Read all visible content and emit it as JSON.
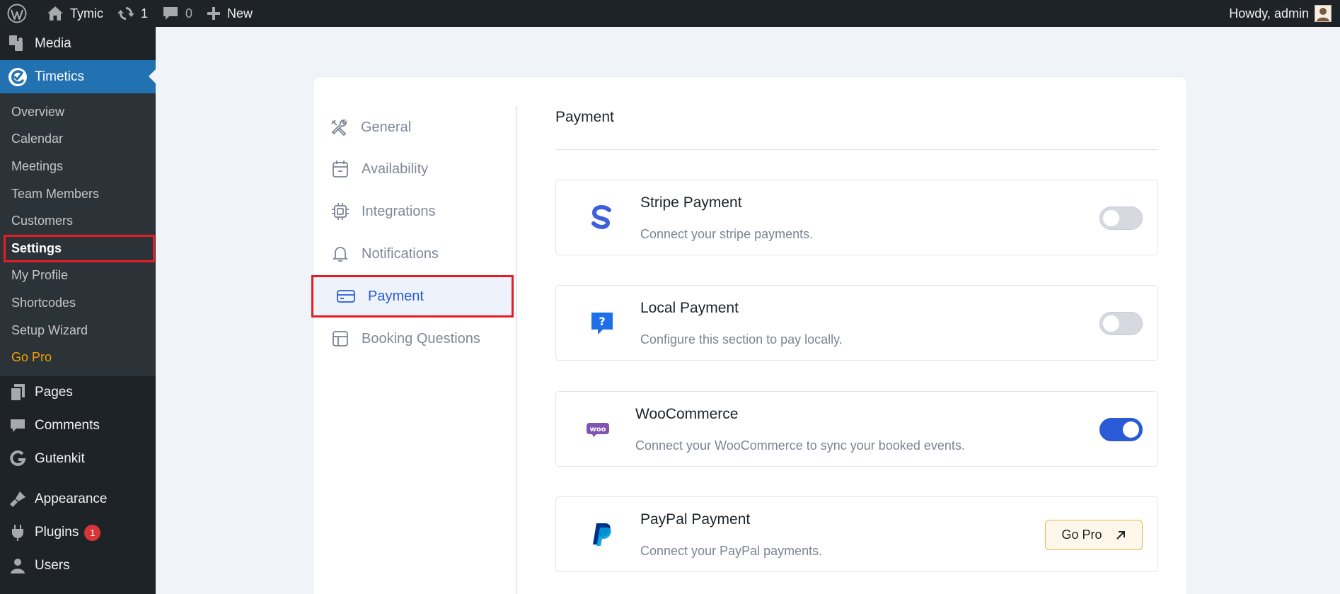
{
  "admin_bar": {
    "site_name": "Tymic",
    "updates_count": "1",
    "comments_count": "0",
    "new_label": "New",
    "howdy": "Howdy, admin"
  },
  "sidebar": {
    "items": [
      {
        "label": "Media",
        "icon": "media-icon"
      },
      {
        "label": "Timetics",
        "icon": "timetics-icon"
      },
      {
        "label": "Pages",
        "icon": "pages-icon"
      },
      {
        "label": "Comments",
        "icon": "comments-icon"
      },
      {
        "label": "Gutenkit",
        "icon": "gutenkit-icon"
      },
      {
        "label": "Appearance",
        "icon": "appearance-icon"
      },
      {
        "label": "Plugins",
        "icon": "plugins-icon",
        "badge": "1"
      },
      {
        "label": "Users",
        "icon": "users-icon"
      }
    ],
    "submenu": [
      "Overview",
      "Calendar",
      "Meetings",
      "Team Members",
      "Customers",
      "Settings",
      "My Profile",
      "Shortcodes",
      "Setup Wizard",
      "Go Pro"
    ]
  },
  "settings_tabs": [
    {
      "label": "General",
      "icon": "tools-icon"
    },
    {
      "label": "Availability",
      "icon": "calendar-icon"
    },
    {
      "label": "Integrations",
      "icon": "chip-icon"
    },
    {
      "label": "Notifications",
      "icon": "bell-icon"
    },
    {
      "label": "Payment",
      "icon": "credit-card-icon"
    },
    {
      "label": "Booking Questions",
      "icon": "layout-icon"
    }
  ],
  "payment": {
    "title": "Payment",
    "methods": [
      {
        "title": "Stripe Payment",
        "desc": "Connect your stripe payments.",
        "enabled": false,
        "icon": "stripe-icon"
      },
      {
        "title": "Local Payment",
        "desc": "Configure this section to pay locally.",
        "enabled": false,
        "icon": "local-payment-icon"
      },
      {
        "title": "WooCommerce",
        "desc": "Connect your WooCommerce to sync your booked events.",
        "enabled": true,
        "icon": "woocommerce-icon"
      },
      {
        "title": "PayPal Payment",
        "desc": "Connect your PayPal payments.",
        "action": "Go Pro",
        "icon": "paypal-icon"
      }
    ]
  },
  "colors": {
    "accent": "#2271b1",
    "active_tab": "#2959d6",
    "highlight": "#e51c23",
    "pro": "#f0a000"
  }
}
